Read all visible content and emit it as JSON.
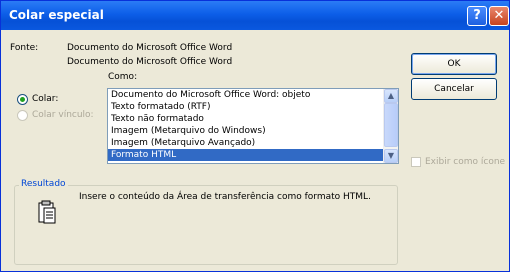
{
  "window": {
    "title": "Colar especial"
  },
  "titlebar": {
    "help_icon": "?",
    "close_icon": "✕"
  },
  "source": {
    "label": "Fonte:",
    "line1": "Documento do Microsoft Office Word",
    "line2": "Documento do Microsoft Office Word",
    "as_label": "Como:"
  },
  "options": {
    "paste_label": "Colar:",
    "paste_link_label": "Colar vínculo:"
  },
  "list": {
    "items": [
      "Documento do Microsoft Office Word: objeto",
      "Texto formatado (RTF)",
      "Texto não formatado",
      "Imagem (Metarquivo do Windows)",
      "Imagem (Metarquivo Avançado)",
      "Formato HTML"
    ],
    "selected_index": 5,
    "scroll_up": "▲",
    "scroll_down": "▼"
  },
  "buttons": {
    "ok": "OK",
    "cancel": "Cancelar"
  },
  "display_as_icon": {
    "label": "Exibir como ícone",
    "checked": false
  },
  "result": {
    "title": "Resultado",
    "text": "Insere o conteúdo da Área de transferência como formato HTML."
  },
  "colors": {
    "titlebar": "#0c5ee8",
    "selection": "#316ac5",
    "group_title": "#0046d5"
  }
}
